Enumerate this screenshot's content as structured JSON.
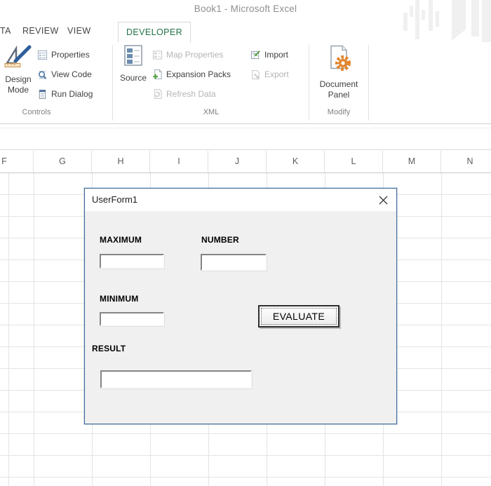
{
  "window": {
    "title": "Book1 - Microsoft Excel"
  },
  "ribbon": {
    "tabs": [
      "TA",
      "REVIEW",
      "VIEW",
      "DEVELOPER"
    ],
    "groups": {
      "controls": {
        "label": "Controls",
        "design_mode_label": "Design Mode",
        "buttons": [
          "Properties",
          "View Code",
          "Run Dialog"
        ]
      },
      "xml": {
        "label": "XML",
        "source_label": "Source",
        "items": [
          {
            "label": "Map Properties",
            "enabled": false
          },
          {
            "label": "Expansion Packs",
            "enabled": true
          },
          {
            "label": "Refresh Data",
            "enabled": false
          },
          {
            "label": "Import",
            "enabled": true
          },
          {
            "label": "Export",
            "enabled": false
          }
        ]
      },
      "modify": {
        "label": "Modify",
        "document_panel_label": "Document Panel"
      }
    }
  },
  "sheet": {
    "column_headers": [
      "F",
      "G",
      "H",
      "I",
      "J",
      "K",
      "L",
      "M",
      "N"
    ]
  },
  "dialog": {
    "title": "UserForm1",
    "close_icon": "close-x",
    "fields": [
      {
        "label": "MAXIMUM",
        "value": ""
      },
      {
        "label": "NUMBER",
        "value": ""
      },
      {
        "label": "MINIMUM",
        "value": ""
      },
      {
        "label": "RESULT",
        "value": ""
      }
    ],
    "evaluate_button_label": "EVALUATE"
  },
  "colors": {
    "developer_tab_green": "#217346",
    "dialog_border_blue": "#3f6b99",
    "gear_orange": "#e2862c"
  }
}
